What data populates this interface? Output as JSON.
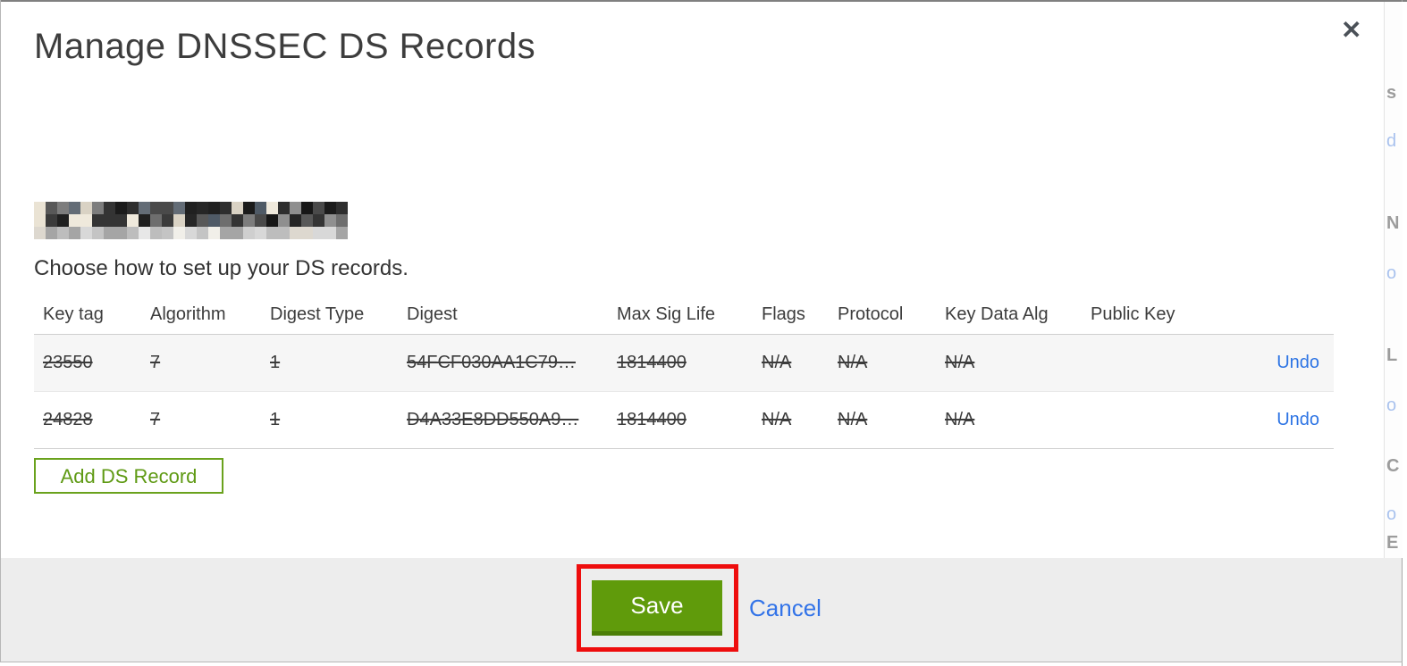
{
  "modal": {
    "title": "Manage DNSSEC DS Records",
    "close_icon": "✕",
    "subtitle": "Choose how to set up your DS records.",
    "add_ds_record_label": "Add DS Record",
    "footer": {
      "save_label": "Save",
      "cancel_label": "Cancel"
    }
  },
  "table": {
    "columns": [
      "Key tag",
      "Algorithm",
      "Digest Type",
      "Digest",
      "Max Sig Life",
      "Flags",
      "Protocol",
      "Key Data Alg",
      "Public Key"
    ],
    "rows": [
      {
        "cells": [
          "23550",
          "7",
          "1",
          "54FCF030AA1C79…",
          "1814400",
          "N/A",
          "N/A",
          "N/A",
          ""
        ],
        "action": "Undo",
        "struck": true
      },
      {
        "cells": [
          "24828",
          "7",
          "1",
          "D4A33E8DD550A9…",
          "1814400",
          "N/A",
          "N/A",
          "N/A",
          ""
        ],
        "action": "Undo",
        "struck": true
      }
    ]
  },
  "annotation": {
    "highlight_color": "#ee0d0d",
    "target": "save-button"
  },
  "background_page_fragments": [
    {
      "char": "s",
      "tone": "gray"
    },
    {
      "char": "d",
      "tone": "blue"
    },
    {
      "char": "N",
      "tone": "gray"
    },
    {
      "char": "o",
      "tone": "blue"
    },
    {
      "char": "L",
      "tone": "gray"
    },
    {
      "char": "o",
      "tone": "blue"
    },
    {
      "char": "C",
      "tone": "gray"
    },
    {
      "char": "o",
      "tone": "blue"
    },
    {
      "char": "E",
      "tone": "gray"
    }
  ],
  "colors": {
    "accent_green": "#609b0b",
    "accent_green_dark": "#4c7e06",
    "outline_green": "#6aa21d",
    "link_blue": "#2d74e4",
    "footer_gray": "#ededed",
    "row_stripe": "#f6f6f6"
  }
}
